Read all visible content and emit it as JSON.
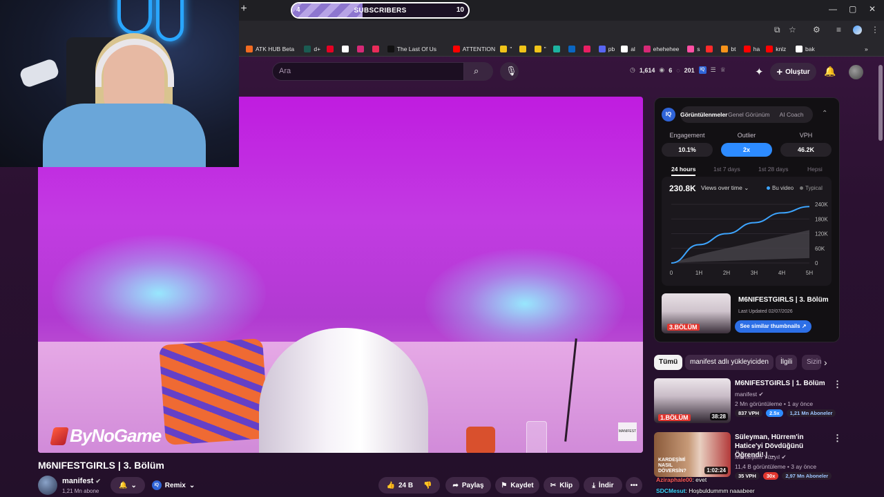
{
  "subscriber_goal": {
    "current": "4",
    "label": "SUBSCRIBERS",
    "target": "10",
    "progress": 0.4
  },
  "browser": {
    "new_tab": "+",
    "window_controls": [
      "—",
      "▢",
      "✕"
    ],
    "bookmarks": [
      {
        "label": "ATK HUB Beta",
        "color": "#f26b21"
      },
      {
        "label": "d+",
        "color": "#1b5b52"
      },
      {
        "label": "",
        "color": "#e60023"
      },
      {
        "label": "",
        "color": "#ffffff"
      },
      {
        "label": "",
        "color": "#d62976"
      },
      {
        "label": "",
        "color": "#ea2c59"
      },
      {
        "label": "The Last Of Us",
        "color": "#111111"
      },
      {
        "label": "ATTENTION",
        "color": "#ff0000"
      },
      {
        "label": "\"",
        "color": "#f0c419"
      },
      {
        "label": "",
        "color": "#f0c419"
      },
      {
        "label": "\"",
        "color": "#f0c419"
      },
      {
        "label": "",
        "color": "#1db3a0"
      },
      {
        "label": "",
        "color": "#0a66c2"
      },
      {
        "label": "",
        "color": "#e91e63"
      },
      {
        "label": "pb",
        "color": "#5865f2"
      },
      {
        "label": "al",
        "color": "#ffffff"
      },
      {
        "label": "ehehehee",
        "color": "#d62976"
      },
      {
        "label": "s",
        "color": "#ff4fa3"
      },
      {
        "label": "",
        "color": "#ff2a2a"
      },
      {
        "label": "bt",
        "color": "#f7931a"
      },
      {
        "label": "ha",
        "color": "#ff0000"
      },
      {
        "label": "knlz",
        "color": "#ff0000"
      },
      {
        "label": "bak",
        "color": "#ffffff"
      }
    ],
    "more": "»"
  },
  "youtube": {
    "search_placeholder": "Ara",
    "stats": {
      "views": "1,614",
      "eye": "6",
      "count": "201"
    },
    "create_label": "Oluştur",
    "video": {
      "watermark": "ByNoGame",
      "bug": "MANIFEST",
      "title": "M6NIFESTGIRLS | 3. Bölüm",
      "channel": "manifest",
      "subscribers": "1,21 Mn abone",
      "remix": "Remix",
      "likes": "24 B",
      "share": "Paylaş",
      "save": "Kaydet",
      "clip": "Klip",
      "download": "İndir",
      "more": "•••"
    },
    "iq": {
      "logo": "IQ",
      "tabs": [
        "Görüntülenmeler",
        "Genel Görünüm",
        "AI Coach"
      ],
      "metrics": [
        {
          "label": "Engagement",
          "value": "10.1%"
        },
        {
          "label": "Outlier",
          "value": "2x"
        },
        {
          "label": "VPH",
          "value": "46.2K"
        }
      ],
      "ranges": [
        "24 hours",
        "1st 7 days",
        "1st 28 days",
        "Hepsi"
      ],
      "chart_total": "230.8K",
      "chart_selector": "Views over time",
      "legend": [
        "Bu video",
        "Typical"
      ],
      "thumb_title": "M6NIFESTGIRLS | 3. Bölüm",
      "thumb_updated": "Last Updated 02/07/2026",
      "thumb_badge": "3.BÖLÜM",
      "similar_button": "See similar thumbnails ↗"
    },
    "chips": [
      "Tümü",
      "manifest adlı yükleyiciden",
      "İlgili",
      "Sizin için"
    ],
    "recommended": [
      {
        "title": "M6NIFESTGIRLS | 1. Bölüm",
        "channel": "manifest",
        "meta": "2 Mn görüntüleme • 1 ay önce",
        "badges": [
          "837 VPH",
          "2.5x",
          "1,21 Mn Aboneler"
        ],
        "duration": "38:28",
        "thumb_caption": "1.BÖLÜM"
      },
      {
        "title": "Süleyman, Hürrem'in Hatice'yi Dövdüğünü Öğrendi! | ...",
        "channel": "Muhteşem Yüzyıl",
        "meta": "11,4 B görüntüleme • 3 ay önce",
        "badges": [
          "35 VPH",
          "30x",
          "2,97 Mn Aboneler"
        ],
        "duration": "1:02:24",
        "thumb_caption": "KARDEŞİMİ NASIL DÖVERSİN?"
      }
    ],
    "chat": [
      {
        "user": "Aziraphale00",
        "message": ": evet"
      },
      {
        "user": "SDCMesut",
        "message": ": Hoşbuldummm naaabeer"
      }
    ]
  },
  "chart_data": {
    "type": "line",
    "title": "230.8K",
    "x": [
      "0",
      "1H",
      "2H",
      "3H",
      "4H",
      "5H"
    ],
    "xlabel": "",
    "ylabel": "",
    "ylim": [
      0,
      240000
    ],
    "yticks": [
      "240K",
      "180K",
      "120K",
      "60K",
      "0"
    ],
    "series": [
      {
        "name": "Bu video",
        "values": [
          0,
          75000,
          120000,
          165000,
          205000,
          230800
        ]
      },
      {
        "name": "Typical",
        "values": [
          0,
          35000,
          60000,
          85000,
          110000,
          135000
        ]
      }
    ]
  }
}
